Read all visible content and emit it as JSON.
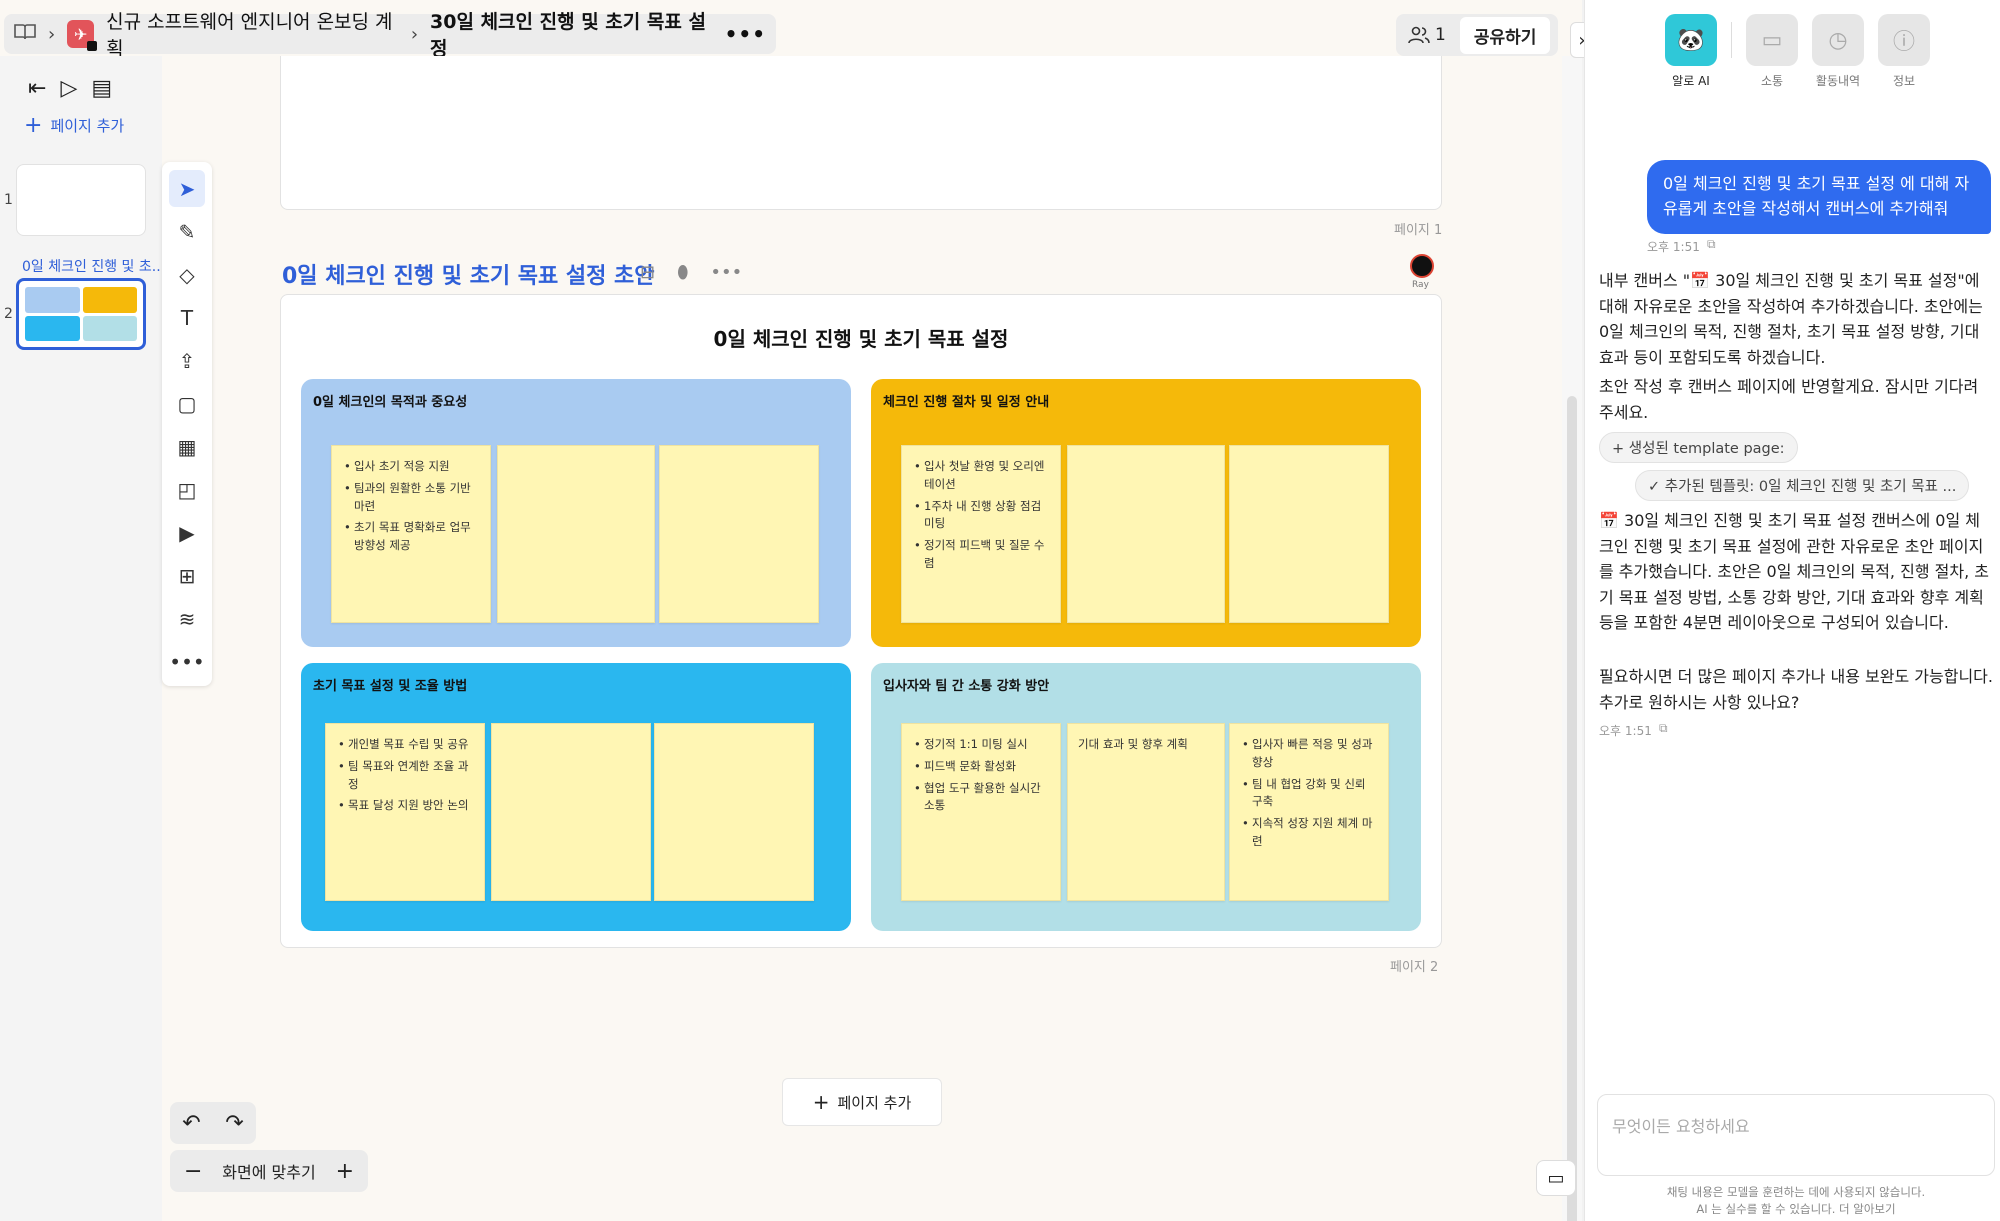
{
  "breadcrumb": {
    "book_icon": "book-icon",
    "workspace": "신규 소프트웨어 엔지니어 온보딩 계획",
    "page": "30일 체크인 진행 및 초기 목표 설정",
    "more": "•••"
  },
  "header": {
    "member_count": "1",
    "share_label": "공유하기"
  },
  "left_panel": {
    "add_page": "페이지 추가",
    "thumb1_number": "1",
    "thumb2_number": "2",
    "thumb2_title": "0일 체크인 진행 및 초..."
  },
  "canvas": {
    "page1_label": "페이지 1",
    "page2_label": "페이지 2",
    "page2_title": "0일 체크인 진행 및 초기 목표 설정 초안",
    "avatar_name": "Ray",
    "add_page": "페이지 추가",
    "zoom_label": "화면에 맞추기",
    "board": {
      "title": "0일 체크인 진행 및 초기 목표 설정",
      "quadrants": [
        {
          "title": "0일 체크인의 목적과 중요성",
          "color": "#a9cbf1",
          "notes": [
            [
              "입사 초기 적응 지원",
              "팀과의 원활한 소통 기반 마련",
              "초기 목표 명확화로 업무 방향성 제공"
            ],
            [],
            []
          ]
        },
        {
          "title": "체크인 진행 절차 및 일정 안내",
          "color": "#f5b90a",
          "notes": [
            [
              "입사 첫날 환영 및 오리엔테이션",
              "1주차 내 진행 상황 점검 미팅",
              "정기적 피드백 및 질문 수렴"
            ],
            [],
            []
          ]
        },
        {
          "title": "초기 목표 설정 및 조율 방법",
          "color": "#2ab7ef",
          "notes": [
            [
              "개인별 목표 수립 및 공유",
              "팀 목표와 연계한 조율 과정",
              "목표 달성 지원 방안 논의"
            ],
            [],
            []
          ]
        },
        {
          "title": "입사자와 팀 간 소통 강화 방안",
          "color": "#b2dfe7",
          "notes": [
            [
              "정기적 1:1 미팅 실시",
              "피드백 문화 활성화",
              "협업 도구 활용한 실시간 소통"
            ],
            "기대 효과 및 향후 계획",
            [
              "입사자 빠른 적응 및 성과 향상",
              "팀 내 협업 강화 및 신뢰 구축",
              "지속적 성장 지원 체계 마련"
            ]
          ]
        }
      ]
    }
  },
  "right_panel": {
    "tabs": [
      {
        "label": "알로 AI",
        "icon": "panda-icon"
      },
      {
        "label": "소통",
        "icon": "chat-icon"
      },
      {
        "label": "활동내역",
        "icon": "clock-icon"
      },
      {
        "label": "정보",
        "icon": "info-icon"
      }
    ],
    "user_message": "0일 체크인 진행 및 초기 목표 설정 에 대해 자유롭게 초안을 작성해서 캔버스에 추가해줘",
    "user_time": "오후 1:51",
    "ai_para1": "내부 캔버스 \"📅 30일 체크인 진행 및 초기 목표 설정\"에 대해 자유로운 초안을 작성하여 추가하겠습니다. 초안에는 0일 체크인의 목적, 진행 절차, 초기 목표 설정 방향, 기대 효과 등이 포함되도록 하겠습니다.",
    "ai_para2": "초안 작성 후 캔버스 페이지에 반영할게요. 잠시만 기다려 주세요.",
    "chip1": "생성된 template page:",
    "chip2": "추가된 템플릿: 0일 체크인 진행 및 초기 목표 ...",
    "ai_para3": "📅 30일 체크인 진행 및 초기 목표 설정 캔버스에 0일 체크인 진행 및 초기 목표 설정에 관한 자유로운 초안 페이지를 추가했습니다. 초안은 0일 체크인의 목적, 진행 절차, 초기 목표 설정 방법, 소통 강화 방안, 기대 효과와 향후 계획 등을 포함한 4분면 레이아웃으로 구성되어 있습니다.",
    "ai_para4": "필요하시면 더 많은 페이지 추가나 내용 보완도 가능합니다. 추가로 원하시는 사항 있나요?",
    "ai_time": "오후 1:51",
    "input_placeholder": "무엇이든 요청하세요",
    "disclaimer1": "채팅 내용은 모델을 훈련하는 데에 사용되지 않습니다.",
    "disclaimer2": "AI 는 실수를 할 수 있습니다. 더 알아보기"
  }
}
